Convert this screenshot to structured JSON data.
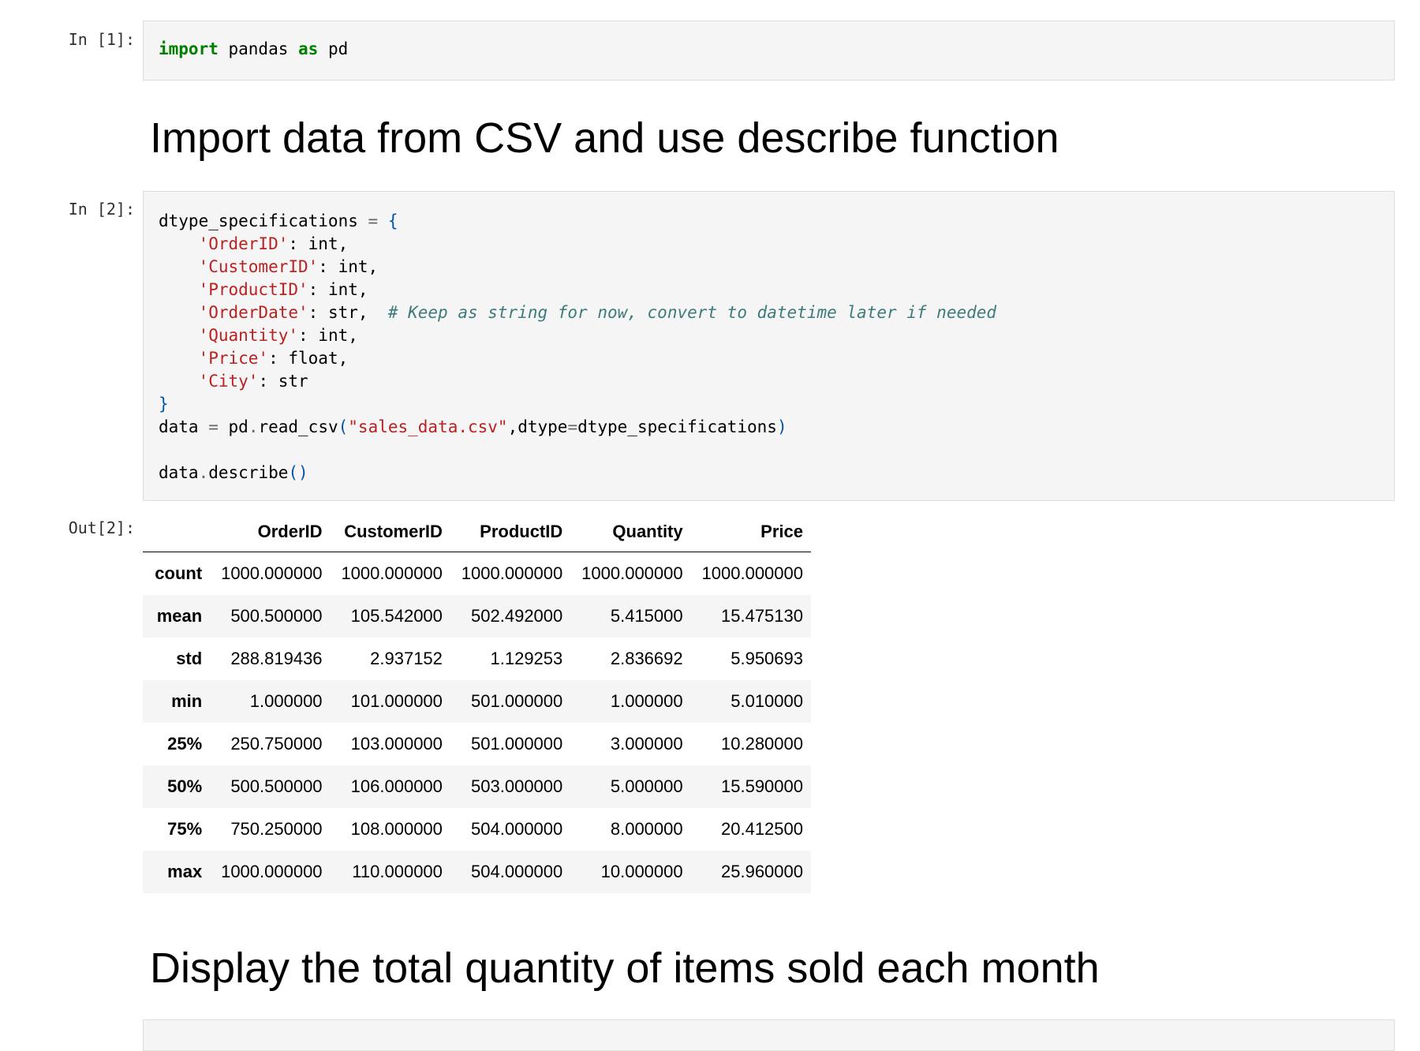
{
  "cells": {
    "in1": {
      "prompt": "In [1]:",
      "code": [
        [
          [
            "import",
            "kw"
          ],
          [
            " pandas ",
            ""
          ],
          [
            "as",
            "kw"
          ],
          [
            " pd",
            ""
          ]
        ]
      ]
    },
    "md1": {
      "heading": "Import data from CSV and use describe function"
    },
    "in2": {
      "prompt": "In [2]:",
      "code": [
        [
          [
            "dtype_specifications ",
            ""
          ],
          [
            "=",
            "op"
          ],
          [
            " {",
            "br"
          ]
        ],
        [
          [
            "    ",
            ""
          ],
          [
            "'OrderID'",
            "str"
          ],
          [
            ": int,",
            ""
          ]
        ],
        [
          [
            "    ",
            ""
          ],
          [
            "'CustomerID'",
            "str"
          ],
          [
            ": int,",
            ""
          ]
        ],
        [
          [
            "    ",
            ""
          ],
          [
            "'ProductID'",
            "str"
          ],
          [
            ": int,",
            ""
          ]
        ],
        [
          [
            "    ",
            ""
          ],
          [
            "'OrderDate'",
            "str"
          ],
          [
            ": str,  ",
            ""
          ],
          [
            "# Keep as string for now, convert to datetime later if needed",
            "cm"
          ]
        ],
        [
          [
            "    ",
            ""
          ],
          [
            "'Quantity'",
            "str"
          ],
          [
            ": int,",
            ""
          ]
        ],
        [
          [
            "    ",
            ""
          ],
          [
            "'Price'",
            "str"
          ],
          [
            ": float,",
            ""
          ]
        ],
        [
          [
            "    ",
            ""
          ],
          [
            "'City'",
            "str"
          ],
          [
            ": str",
            ""
          ]
        ],
        [
          [
            "}",
            "br"
          ]
        ],
        [
          [
            "data ",
            ""
          ],
          [
            "=",
            "op"
          ],
          [
            " pd",
            ""
          ],
          [
            ".",
            "op"
          ],
          [
            "read_csv",
            ""
          ],
          [
            "(",
            "br"
          ],
          [
            "\"sales_data.csv\"",
            "str"
          ],
          [
            ",dtype",
            ""
          ],
          [
            "=",
            "op"
          ],
          [
            "dtype_specifications",
            ""
          ],
          [
            ")",
            "br"
          ]
        ],
        [
          [
            "",
            ""
          ]
        ],
        [
          [
            "data",
            ""
          ],
          [
            ".",
            "op"
          ],
          [
            "describe",
            ""
          ],
          [
            "()",
            "br"
          ]
        ]
      ]
    },
    "out2": {
      "prompt": "Out[2]:",
      "columns": [
        "",
        "OrderID",
        "CustomerID",
        "ProductID",
        "Quantity",
        "Price"
      ],
      "rows": [
        [
          "count",
          "1000.000000",
          "1000.000000",
          "1000.000000",
          "1000.000000",
          "1000.000000"
        ],
        [
          "mean",
          "500.500000",
          "105.542000",
          "502.492000",
          "5.415000",
          "15.475130"
        ],
        [
          "std",
          "288.819436",
          "2.937152",
          "1.129253",
          "2.836692",
          "5.950693"
        ],
        [
          "min",
          "1.000000",
          "101.000000",
          "501.000000",
          "1.000000",
          "5.010000"
        ],
        [
          "25%",
          "250.750000",
          "103.000000",
          "501.000000",
          "3.000000",
          "10.280000"
        ],
        [
          "50%",
          "500.500000",
          "106.000000",
          "503.000000",
          "5.000000",
          "15.590000"
        ],
        [
          "75%",
          "750.250000",
          "108.000000",
          "504.000000",
          "8.000000",
          "20.412500"
        ],
        [
          "max",
          "1000.000000",
          "110.000000",
          "504.000000",
          "10.000000",
          "25.960000"
        ]
      ]
    },
    "md2": {
      "heading": "Display the total quantity of items sold each month"
    }
  }
}
